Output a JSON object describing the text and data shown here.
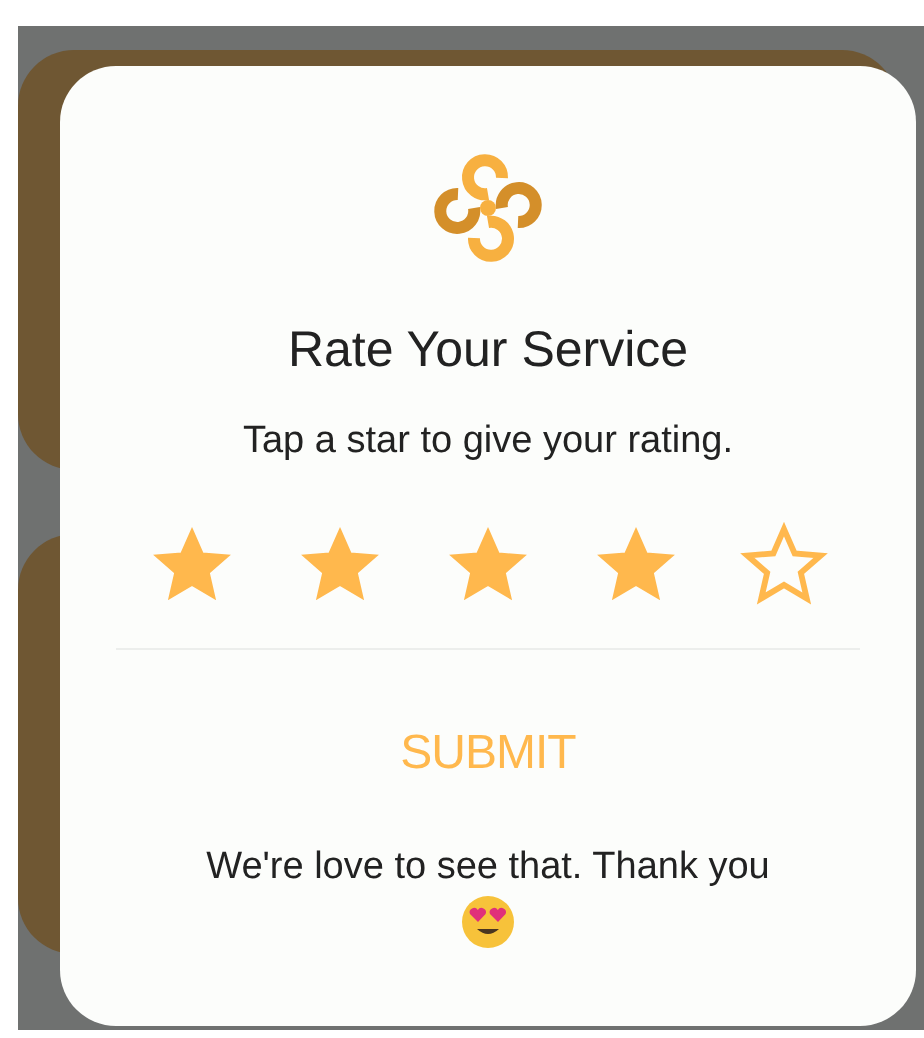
{
  "dialog": {
    "title": "Rate Your Service",
    "subtitle": "Tap a star to give your rating.",
    "rating": {
      "stars": 4
    },
    "submit": "SUBMIT",
    "message": "We're love to see that. Thank you"
  }
}
